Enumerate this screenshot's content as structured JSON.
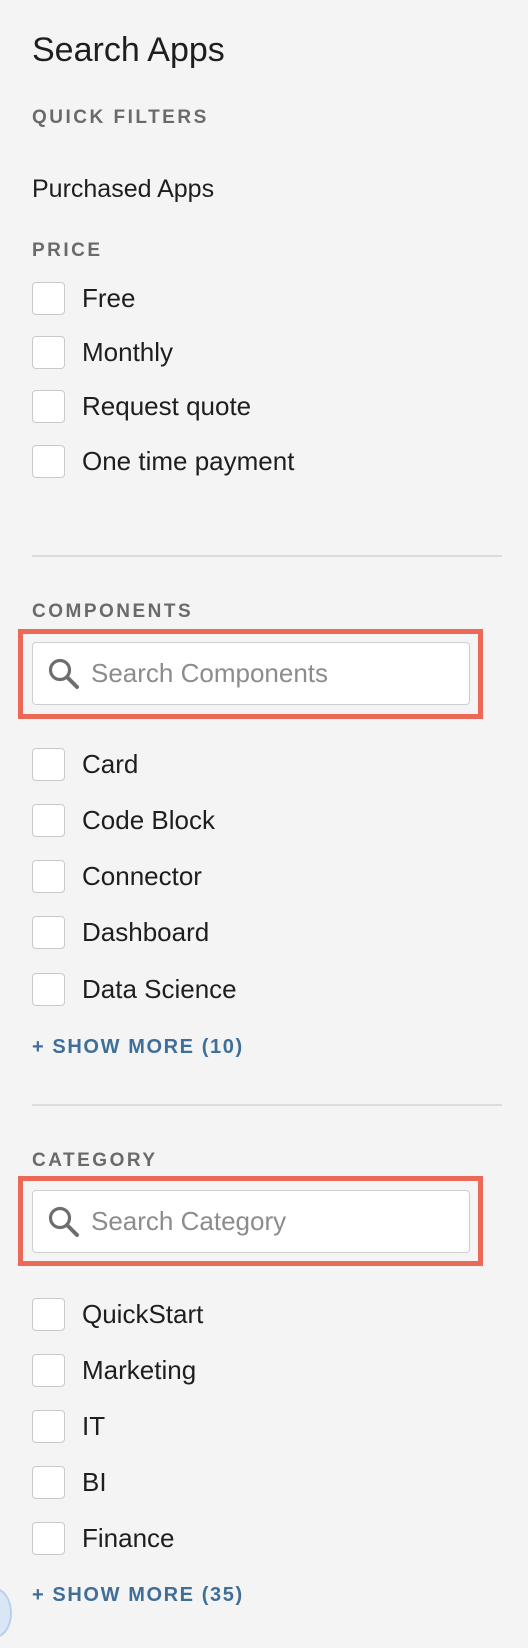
{
  "header": {
    "title": "Search Apps"
  },
  "quick_filters": {
    "label": "QUICK FILTERS",
    "links": [
      "Purchased Apps"
    ]
  },
  "price": {
    "label": "PRICE",
    "options": [
      "Free",
      "Monthly",
      "Request quote",
      "One time payment"
    ]
  },
  "components": {
    "label": "COMPONENTS",
    "search_placeholder": "Search Components",
    "search_value": "",
    "options": [
      "Card",
      "Code Block",
      "Connector",
      "Dashboard",
      "Data Science"
    ],
    "show_more": "+ SHOW MORE (10)"
  },
  "category": {
    "label": "CATEGORY",
    "search_placeholder": "Search Category",
    "search_value": "",
    "options": [
      "QuickStart",
      "Marketing",
      "IT",
      "BI",
      "Finance"
    ],
    "show_more": "+ SHOW MORE (35)"
  },
  "icons": {
    "search": "search-icon",
    "checkbox": "checkbox-unchecked"
  },
  "colors": {
    "background": "#f4f4f4",
    "highlight": "#ec6857",
    "link": "#3f6f98",
    "section_label": "#6a6a6a"
  }
}
